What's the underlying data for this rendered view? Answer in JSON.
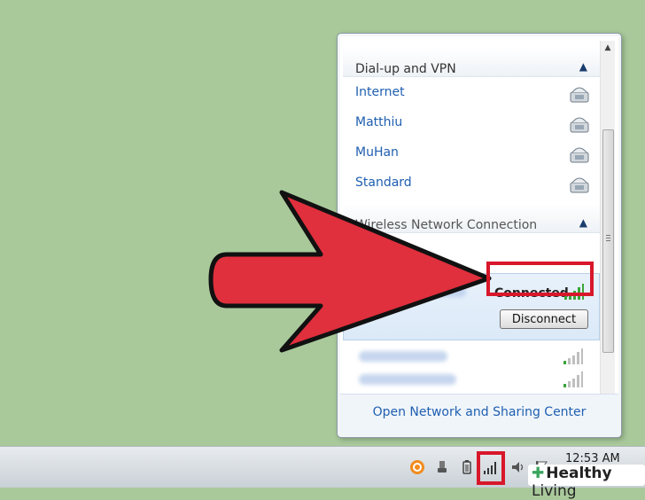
{
  "flyout": {
    "dialup_section": {
      "title": "Dial-up and VPN",
      "items": [
        {
          "label": "Internet"
        },
        {
          "label": "Matthiu"
        },
        {
          "label": "MuHan"
        },
        {
          "label": "Standard"
        }
      ]
    },
    "wireless_section": {
      "title": "Wireless Network Connection",
      "connected_status": "Connected",
      "disconnect_label": "Disconnect"
    },
    "footer_link": "Open Network and Sharing Center"
  },
  "taskbar": {
    "clock": "12:53 AM"
  },
  "watermark": {
    "text_bold": "Healthy",
    "text": "Living"
  },
  "colors": {
    "desktop": "#a9c99b",
    "link_blue": "#1f5fb0",
    "arrow_red": "#e02f3d",
    "highlight_red": "#d8172a"
  }
}
